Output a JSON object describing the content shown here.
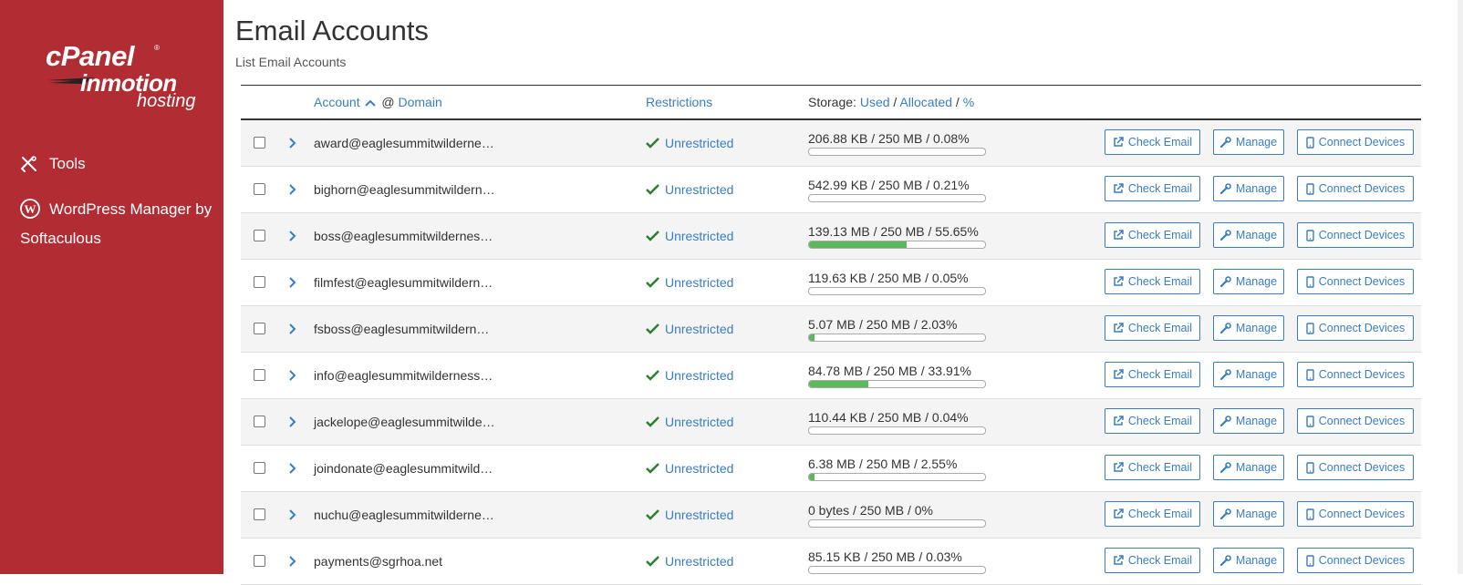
{
  "sidebar": {
    "logo_cpanel": "cPanel",
    "logo_inmotion": "inmotion",
    "logo_hosting": "hosting",
    "nav": [
      {
        "label": "Tools",
        "icon": "tools-icon"
      },
      {
        "label": "WordPress Manager by Softaculous",
        "icon": "wordpress-icon"
      }
    ]
  },
  "page": {
    "title": "Email Accounts",
    "subtitle": "List Email Accounts"
  },
  "table": {
    "headers": {
      "account": "Account",
      "at": "@",
      "domain": "Domain",
      "restrictions": "Restrictions",
      "storage_prefix": "Storage:",
      "used": "Used",
      "allocated": "Allocated",
      "percent": "%"
    },
    "button_labels": {
      "check": "Check Email",
      "manage": "Manage",
      "connect": "Connect Devices"
    },
    "rows": [
      {
        "account": "award@eaglesummitwilderne…",
        "restriction": "Unrestricted",
        "storage": "206.88 KB / 250 MB / 0.08%",
        "percent": 0.08
      },
      {
        "account": "bighorn@eaglesummitwildern…",
        "restriction": "Unrestricted",
        "storage": "542.99 KB / 250 MB / 0.21%",
        "percent": 0.21
      },
      {
        "account": "boss@eaglesummitwildernes…",
        "restriction": "Unrestricted",
        "storage": "139.13 MB / 250 MB / 55.65%",
        "percent": 55.65
      },
      {
        "account": "filmfest@eaglesummitwildern…",
        "restriction": "Unrestricted",
        "storage": "119.63 KB / 250 MB / 0.05%",
        "percent": 0.05
      },
      {
        "account": "fsboss@eaglesummitwildern…",
        "restriction": "Unrestricted",
        "storage": "5.07 MB / 250 MB / 2.03%",
        "percent": 2.03
      },
      {
        "account": "info@eaglesummitwilderness…",
        "restriction": "Unrestricted",
        "storage": "84.78 MB / 250 MB / 33.91%",
        "percent": 33.91
      },
      {
        "account": "jackelope@eaglesummitwilde…",
        "restriction": "Unrestricted",
        "storage": "110.44 KB / 250 MB / 0.04%",
        "percent": 0.04
      },
      {
        "account": "joindonate@eaglesummitwild…",
        "restriction": "Unrestricted",
        "storage": "6.38 MB / 250 MB / 2.55%",
        "percent": 2.55
      },
      {
        "account": "nuchu@eaglesummitwilderne…",
        "restriction": "Unrestricted",
        "storage": "0 bytes / 250 MB / 0%",
        "percent": 0
      },
      {
        "account": "payments@sgrhoa.net",
        "restriction": "Unrestricted",
        "storage": "85.15 KB / 250 MB / 0.03%",
        "percent": 0.03
      }
    ]
  },
  "colors": {
    "sidebar": "#b12c33",
    "link": "#3a7dbf",
    "success": "#2e7d32",
    "bar_fill": "#5cb85c"
  }
}
